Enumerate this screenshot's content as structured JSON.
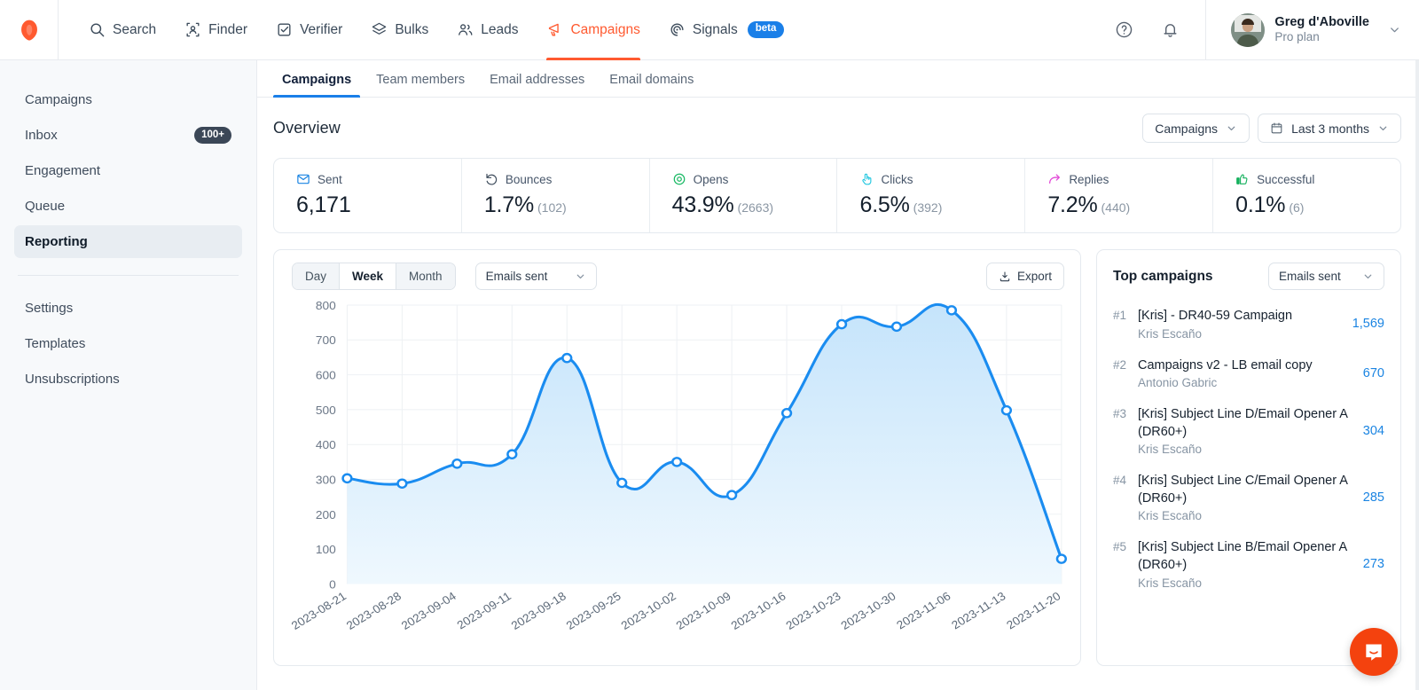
{
  "topnav": {
    "logo": "hunter-logo-icon",
    "items": [
      {
        "label": "Search",
        "icon": "search-icon",
        "active": false
      },
      {
        "label": "Finder",
        "icon": "finder-icon",
        "active": false
      },
      {
        "label": "Verifier",
        "icon": "verifier-icon",
        "active": false
      },
      {
        "label": "Bulks",
        "icon": "bulks-icon",
        "active": false
      },
      {
        "label": "Leads",
        "icon": "leads-icon",
        "active": false
      },
      {
        "label": "Campaigns",
        "icon": "campaigns-icon",
        "active": true
      },
      {
        "label": "Signals",
        "icon": "signals-icon",
        "active": false,
        "badge": "beta"
      }
    ],
    "help_icon": "help-circle-icon",
    "bell_icon": "bell-icon",
    "user": {
      "name": "Greg d'Aboville",
      "plan": "Pro plan"
    }
  },
  "sidebar": {
    "items": [
      {
        "label": "Campaigns",
        "badge": "",
        "active": false
      },
      {
        "label": "Inbox",
        "badge": "100+",
        "active": false
      },
      {
        "label": "Engagement",
        "badge": "",
        "active": false
      },
      {
        "label": "Queue",
        "badge": "",
        "active": false
      },
      {
        "label": "Reporting",
        "badge": "",
        "active": true
      }
    ],
    "items2": [
      {
        "label": "Settings",
        "badge": "",
        "active": false
      },
      {
        "label": "Templates",
        "badge": "",
        "active": false
      },
      {
        "label": "Unsubscriptions",
        "badge": "",
        "active": false
      }
    ]
  },
  "tabs": [
    {
      "label": "Campaigns",
      "active": true
    },
    {
      "label": "Team members",
      "active": false
    },
    {
      "label": "Email addresses",
      "active": false
    },
    {
      "label": "Email domains",
      "active": false
    }
  ],
  "overview": {
    "title": "Overview",
    "campaigns_filter": "Campaigns",
    "date_filter": "Last 3 months"
  },
  "stats": [
    {
      "label": "Sent",
      "icon": "envelope-icon",
      "value": "6,171",
      "sub": "",
      "color": "#1a84e2"
    },
    {
      "label": "Bounces",
      "icon": "undo-icon",
      "value": "1.7%",
      "sub": "(102)",
      "color": "#3c4a5a"
    },
    {
      "label": "Opens",
      "icon": "eye-icon",
      "value": "43.9%",
      "sub": "(2663)",
      "color": "#16b862"
    },
    {
      "label": "Clicks",
      "icon": "pointer-icon",
      "value": "6.5%",
      "sub": "(392)",
      "color": "#21c7e0"
    },
    {
      "label": "Replies",
      "icon": "reply-icon",
      "value": "7.2%",
      "sub": "(440)",
      "color": "#e247d7"
    },
    {
      "label": "Successful",
      "icon": "thumbsup-icon",
      "value": "0.1%",
      "sub": "(6)",
      "color": "#13b05c"
    }
  ],
  "chart_toolbar": {
    "granularity": [
      {
        "label": "Day",
        "active": false
      },
      {
        "label": "Week",
        "active": true
      },
      {
        "label": "Month",
        "active": false
      }
    ],
    "metric_select": "Emails sent",
    "export_label": "Export"
  },
  "chart_data": {
    "type": "area",
    "title": "",
    "xlabel": "",
    "ylabel": "",
    "ylim": [
      0,
      800
    ],
    "yticks": [
      0,
      100,
      200,
      300,
      400,
      500,
      600,
      700,
      800
    ],
    "grid": true,
    "legend": "none",
    "line_color": "#1a8cf0",
    "fill_top_color": "#c5e4fb",
    "fill_bottom_color": "#eff8fe",
    "categories": [
      "2023-08-21",
      "2023-08-28",
      "2023-09-04",
      "2023-09-11",
      "2023-09-18",
      "2023-09-25",
      "2023-10-02",
      "2023-10-09",
      "2023-10-16",
      "2023-10-23",
      "2023-10-30",
      "2023-11-06",
      "2023-11-13",
      "2023-11-20"
    ],
    "series": [
      {
        "name": "Emails sent",
        "values": [
          303,
          288,
          345,
          372,
          648,
          290,
          350,
          255,
          490,
          745,
          738,
          785,
          498,
          72
        ]
      }
    ]
  },
  "top_campaigns": {
    "title": "Top campaigns",
    "metric_select": "Emails sent",
    "items": [
      {
        "rank": "#1",
        "name": "[Kris] - DR40-59 Campaign",
        "owner": "Kris Escaño",
        "value": "1,569"
      },
      {
        "rank": "#2",
        "name": "Campaigns v2 - LB email copy",
        "owner": "Antonio Gabric",
        "value": "670"
      },
      {
        "rank": "#3",
        "name": "[Kris] Subject Line D/Email Opener A (DR60+)",
        "owner": "Kris Escaño",
        "value": "304"
      },
      {
        "rank": "#4",
        "name": "[Kris] Subject Line C/Email Opener A (DR60+)",
        "owner": "Kris Escaño",
        "value": "285"
      },
      {
        "rank": "#5",
        "name": "[Kris] Subject Line B/Email Opener A (DR60+)",
        "owner": "Kris Escaño",
        "value": "273"
      }
    ]
  },
  "chat_widget": {
    "icon": "intercom-chat-icon",
    "color": "#f4420e"
  }
}
